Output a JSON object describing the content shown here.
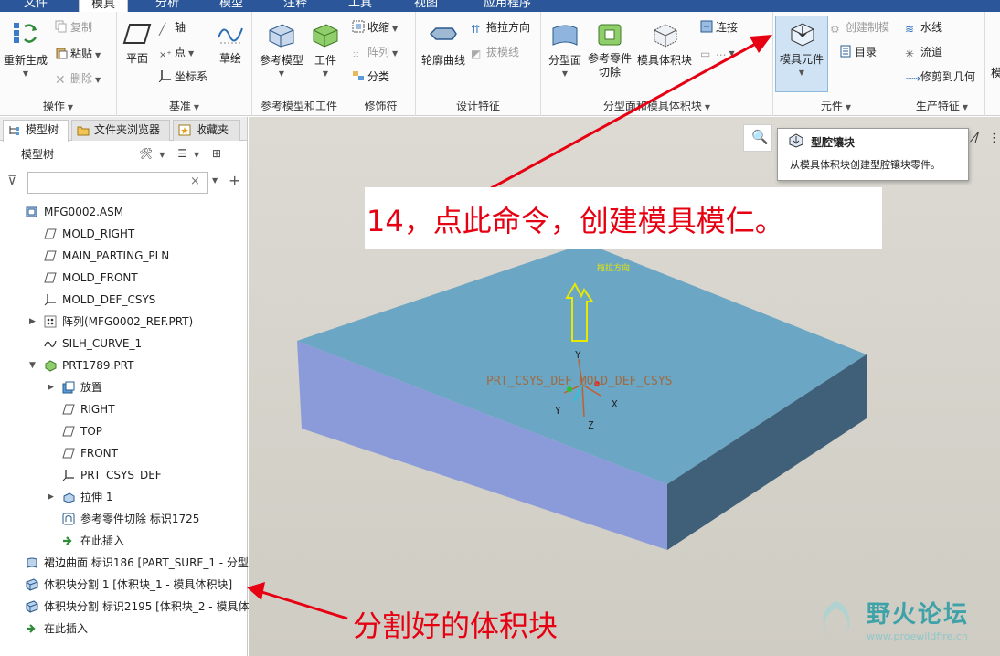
{
  "menu_tabs": [
    "文件",
    "模具",
    "分析",
    "模型",
    "注释",
    "工具",
    "视图",
    "应用程序"
  ],
  "active_tab": "模具",
  "ribbon": {
    "groups": {
      "operations": {
        "label": "操作",
        "regenerate": "重新生成",
        "copy": "复制",
        "paste": "粘贴",
        "delete": "删除"
      },
      "datum": {
        "label": "基准",
        "plane": "平面",
        "axis": "轴",
        "point": "点",
        "csys": "坐标系",
        "sketch": "草绘"
      },
      "ref_model": {
        "label": "参考模型和工件",
        "ref_model": "参考模型",
        "workpiece": "工件"
      },
      "cosmetic": {
        "label": "修饰符",
        "shrink": "收缩",
        "pattern": "阵列",
        "classify": "分类"
      },
      "design_feature": {
        "label": "设计特征",
        "silhouette": "轮廓曲线",
        "draw_dir": "拖拉方向",
        "draft_line": "拔模线"
      },
      "parting": {
        "label": "分型面和模具体积块",
        "parting_surface": "分型面",
        "ref_part_cutout": "参考零件切除",
        "mold_volume": "模具体积块",
        "connect": "连接",
        "hidden": "..."
      },
      "component": {
        "label": "元件",
        "mold_component": "模具元件",
        "create_mold": "创建制模",
        "catalog": "目录"
      },
      "production": {
        "label": "生产特征",
        "waterline": "水线",
        "runner": "流道",
        "trim_geom": "修剪到几何"
      }
    }
  },
  "left_panel": {
    "tabs": [
      "模型树",
      "文件夹浏览器",
      "收藏夹"
    ],
    "tree_header": "模型树",
    "filter_placeholder": "",
    "items": [
      {
        "label": "MFG0002.ASM",
        "icon": "assembly-icon"
      },
      {
        "label": "MOLD_RIGHT",
        "icon": "datum-plane-icon"
      },
      {
        "label": "MAIN_PARTING_PLN",
        "icon": "datum-plane-icon"
      },
      {
        "label": "MOLD_FRONT",
        "icon": "datum-plane-icon"
      },
      {
        "label": "MOLD_DEF_CSYS",
        "icon": "csys-icon"
      },
      {
        "label": "阵列(MFG0002_REF.PRT)",
        "icon": "pattern-icon"
      },
      {
        "label": "SILH_CURVE_1",
        "icon": "curve-icon"
      },
      {
        "label": "PRT1789.PRT",
        "icon": "part-icon"
      },
      {
        "label": "放置",
        "icon": "placement-icon"
      },
      {
        "label": "RIGHT",
        "icon": "datum-plane-icon"
      },
      {
        "label": "TOP",
        "icon": "datum-plane-icon"
      },
      {
        "label": "FRONT",
        "icon": "datum-plane-icon"
      },
      {
        "label": "PRT_CSYS_DEF",
        "icon": "csys-icon"
      },
      {
        "label": "拉伸 1",
        "icon": "extrude-icon"
      },
      {
        "label": "参考零件切除 标识1725",
        "icon": "ref-cutout-icon"
      },
      {
        "label": "在此插入",
        "icon": "insert-here-icon"
      },
      {
        "label": "裙边曲面 标识186 [PART_SURF_1 - 分型",
        "icon": "skirt-surface-icon"
      },
      {
        "label": "体积块分割 1 [体积块_1 - 模具体积块]",
        "icon": "volume-split-icon"
      },
      {
        "label": "体积块分割 标识2195 [体积块_2 - 模具体",
        "icon": "volume-split-icon"
      },
      {
        "label": "在此插入",
        "icon": "insert-here-icon"
      }
    ]
  },
  "tooltip": {
    "title": "型腔镶块",
    "description": "从模具体积块创建型腔镶块零件。"
  },
  "viewport": {
    "draw_dir_label": "拖拉方向",
    "axis_y": "Y",
    "axis_x": "X",
    "axis_z": "Z",
    "csys_label": "PRT_CSYS_DEF MOLD_DEF_CSYS"
  },
  "annotations": {
    "step14": "14，点此命令，创建模具模仁。",
    "split_volume": "分割好的体积块"
  },
  "watermark": {
    "title": "野火论坛",
    "url": "www.proewildfire.cn"
  },
  "colors": {
    "annotation_red": "#e60012",
    "block_top": "#6ba6c4",
    "block_front": "#8b9bd9",
    "block_side": "#3f6078",
    "tab_bar": "#2b579a"
  }
}
